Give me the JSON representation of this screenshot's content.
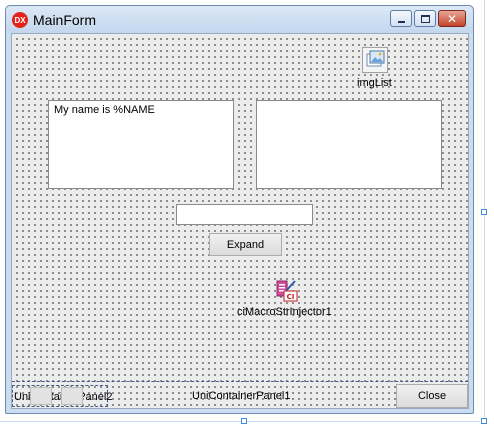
{
  "window": {
    "title": "MainForm",
    "app_icon": "DX"
  },
  "components": {
    "image_list_label": "imgList",
    "injector_label": "ciMacroStrInjector1",
    "injector_icon_text": "CI"
  },
  "memos": {
    "left_text": "My name is %NAME",
    "right_text": ""
  },
  "edit": {
    "value": ""
  },
  "buttons": {
    "expand": "Expand",
    "close": "Close"
  },
  "panels": {
    "inner_label": "UniContainerPanel2",
    "outer_label": "UniContainerPanel1"
  },
  "colors": {
    "title_bar": "#c3d7ee",
    "close_button": "#c3442c",
    "app_icon": "#e2231a"
  }
}
